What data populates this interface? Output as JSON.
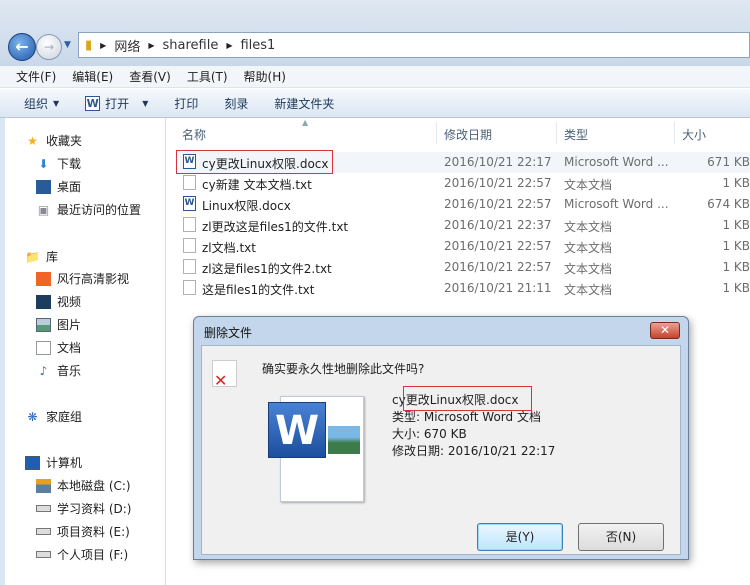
{
  "address": {
    "crumbs": [
      "网络",
      "sharefile",
      "files1"
    ]
  },
  "menu": [
    "文件(F)",
    "编辑(E)",
    "查看(V)",
    "工具(T)",
    "帮助(H)"
  ],
  "toolbar": {
    "organize": "组织",
    "open": "打开",
    "print": "打印",
    "burn": "刻录",
    "new_folder": "新建文件夹"
  },
  "sidebar": {
    "favorites": {
      "label": "收藏夹",
      "items": [
        "下载",
        "桌面",
        "最近访问的位置"
      ]
    },
    "libraries": {
      "label": "库",
      "items": [
        "风行高清影视",
        "视频",
        "图片",
        "文档",
        "音乐"
      ]
    },
    "homegroup": {
      "label": "家庭组"
    },
    "computer": {
      "label": "计算机",
      "items": [
        "本地磁盘 (C:)",
        "学习资料 (D:)",
        "项目资料 (E:)",
        "个人项目 (F:)"
      ]
    }
  },
  "columns": {
    "name": "名称",
    "date": "修改日期",
    "type": "类型",
    "size": "大小"
  },
  "files": [
    {
      "name": "cy更改Linux权限.docx",
      "date": "2016/10/21 22:17",
      "type": "Microsoft Word ...",
      "size": "671 KB",
      "icon": "word"
    },
    {
      "name": "cy新建 文本文档.txt",
      "date": "2016/10/21 22:57",
      "type": "文本文档",
      "size": "1 KB",
      "icon": "txt"
    },
    {
      "name": "Linux权限.docx",
      "date": "2016/10/21 22:57",
      "type": "Microsoft Word ...",
      "size": "674 KB",
      "icon": "word"
    },
    {
      "name": "zl更改这是files1的文件.txt",
      "date": "2016/10/21 22:37",
      "type": "文本文档",
      "size": "1 KB",
      "icon": "txt"
    },
    {
      "name": "zl文档.txt",
      "date": "2016/10/21 22:57",
      "type": "文本文档",
      "size": "1 KB",
      "icon": "txt"
    },
    {
      "name": "zl这是files1的文件2.txt",
      "date": "2016/10/21 22:57",
      "type": "文本文档",
      "size": "1 KB",
      "icon": "txt"
    },
    {
      "name": "这是files1的文件.txt",
      "date": "2016/10/21 21:11",
      "type": "文本文档",
      "size": "1 KB",
      "icon": "txt"
    }
  ],
  "dialog": {
    "title": "删除文件",
    "question": "确实要永久性地删除此文件吗?",
    "file_name": "cy更改Linux权限.docx",
    "type": "类型: Microsoft Word 文档",
    "size": "大小: 670 KB",
    "modified": "修改日期: 2016/10/21 22:17",
    "yes": "是(Y)",
    "no": "否(N)"
  }
}
